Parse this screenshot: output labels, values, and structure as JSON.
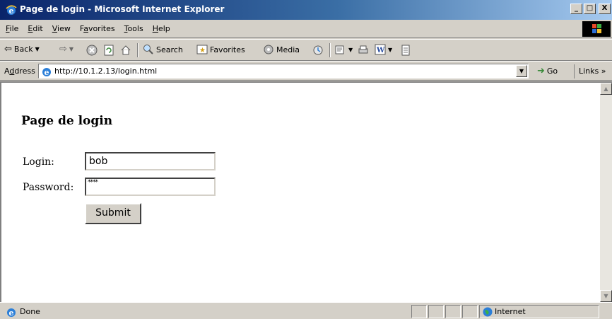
{
  "window": {
    "title": "Page de login - Microsoft Internet Explorer",
    "buttons": [
      "_",
      "□",
      "X"
    ]
  },
  "menu": {
    "items": [
      {
        "first": "F",
        "rest": "ile"
      },
      {
        "first": "E",
        "rest": "dit"
      },
      {
        "first": "V",
        "rest": "iew"
      },
      {
        "pre": "F",
        "first": "a",
        "rest": "vorites"
      },
      {
        "first": "T",
        "rest": "ools"
      },
      {
        "first": "H",
        "rest": "elp"
      }
    ]
  },
  "toolbar": {
    "back": "Back",
    "search": "Search",
    "favorites": "Favorites",
    "media": "Media"
  },
  "address": {
    "label_pre": "A",
    "label_u": "d",
    "label_post": "dress",
    "url": "http://10.1.2.13/login.html",
    "go": "Go",
    "links": "Links »"
  },
  "page": {
    "heading": "Page de login",
    "login_label": "Login:",
    "login_value": "bob",
    "password_label": "Password:",
    "password_mask": "****",
    "submit_label": "Submit"
  },
  "status": {
    "text": "Done",
    "zone": "Internet"
  },
  "colors": {
    "titlebar_start": "#0a246a",
    "titlebar_end": "#a6caf0",
    "chrome": "#d4d0c8"
  }
}
